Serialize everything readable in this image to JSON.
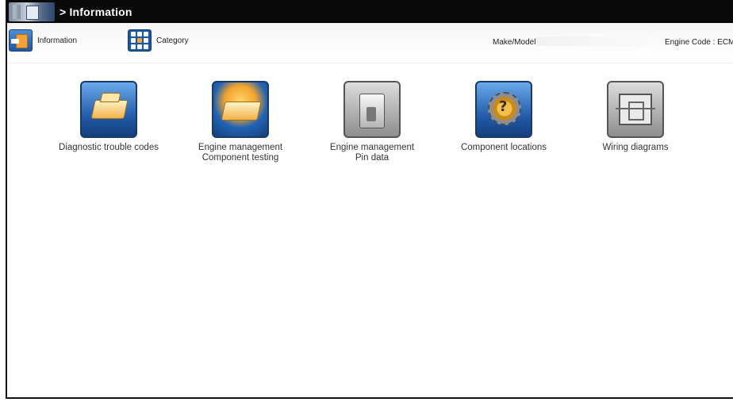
{
  "window": {
    "title": "> Information"
  },
  "toolbar": {
    "information_label": "Information",
    "category_label": "Category",
    "make_model_label": "Make/Model :",
    "engine_code_label": "Engine Code : ECM"
  },
  "tiles": [
    {
      "line1": "Diagnostic trouble codes",
      "line2": "",
      "icon": "diagnostic-trouble-codes-icon"
    },
    {
      "line1": "Engine management",
      "line2": "Component testing",
      "icon": "component-testing-icon"
    },
    {
      "line1": "Engine management",
      "line2": "Pin data",
      "icon": "pin-data-icon"
    },
    {
      "line1": "Component locations",
      "line2": "",
      "icon": "component-locations-icon"
    },
    {
      "line1": "Wiring diagrams",
      "line2": "",
      "icon": "wiring-diagrams-icon"
    }
  ],
  "colors": {
    "title_bar": "#0a0a0a",
    "icon_blue": "#1f59a8",
    "icon_orange": "#f2a53c",
    "icon_grey": "#8e8e8e"
  }
}
